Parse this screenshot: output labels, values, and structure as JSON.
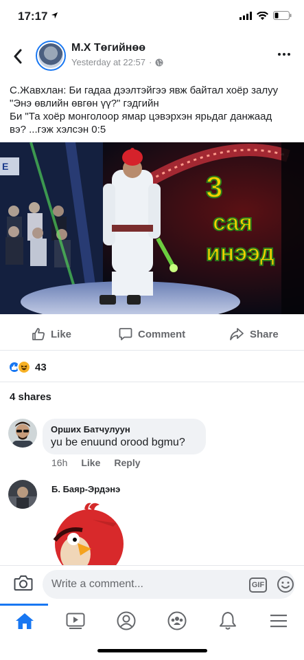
{
  "status_bar": {
    "time": "17:17"
  },
  "post": {
    "author": "М.Х Төгийнөө",
    "timestamp": "Yesterday at 22:57",
    "text_lines": [
      "С.Жавхлан: Би гадаа дээлтэйгээ явж байтал хоёр залуу",
      "\"Энэ өвлийн өвгөн үү?\" гэдгийн",
      "Би \"Та хоёр монголоор ямар цэвэрхэн ярьдаг данжаад",
      "вэ? ...гэж хэлсэн 0:5"
    ],
    "image_sign_text": "3 сая инээд"
  },
  "actions": {
    "like": "Like",
    "comment": "Comment",
    "share": "Share"
  },
  "reactions": {
    "count": "43"
  },
  "shares": "4 shares",
  "comments": [
    {
      "name": "Орших Батчулуун",
      "text": "yu be enuund orood bgmu?",
      "time": "16h",
      "like": "Like",
      "reply": "Reply"
    },
    {
      "name": "Б. Баяр-Эрдэнэ"
    }
  ],
  "comment_bar": {
    "placeholder": "Write a comment...",
    "gif": "GIF"
  },
  "colors": {
    "accent": "#1877f2",
    "muted": "#65676b"
  }
}
